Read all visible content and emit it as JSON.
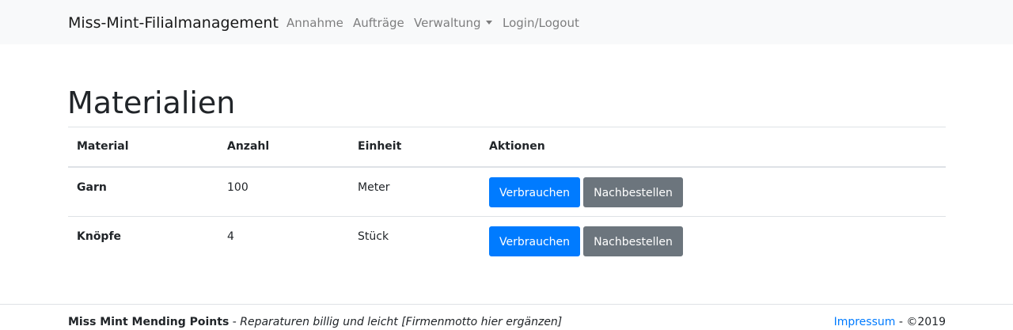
{
  "navbar": {
    "brand": "Miss-Mint-Filialmanagement",
    "items": [
      {
        "label": "Annahme"
      },
      {
        "label": "Aufträge"
      },
      {
        "label": "Verwaltung"
      },
      {
        "label": "Login/Logout"
      }
    ]
  },
  "main": {
    "title": "Materialien",
    "table": {
      "headers": [
        "Material",
        "Anzahl",
        "Einheit",
        "Aktionen"
      ],
      "rows": [
        {
          "material": "Garn",
          "anzahl": "100",
          "einheit": "Meter"
        },
        {
          "material": "Knöpfe",
          "anzahl": "4",
          "einheit": "Stück"
        }
      ],
      "actions": {
        "use_label": "Verbrauchen",
        "reorder_label": "Nachbestellen"
      }
    }
  },
  "footer": {
    "company": "Miss Mint Mending Points",
    "separator": " - ",
    "motto": "Reparaturen billig und leicht [Firmenmotto hier ergänzen]",
    "impressum": "Impressum",
    "copyright": " - ©2019"
  },
  "colors": {
    "primary": "#007bff",
    "secondary": "#6c757d",
    "navbar_bg": "#f8f9fa",
    "border": "#dee2e6"
  }
}
